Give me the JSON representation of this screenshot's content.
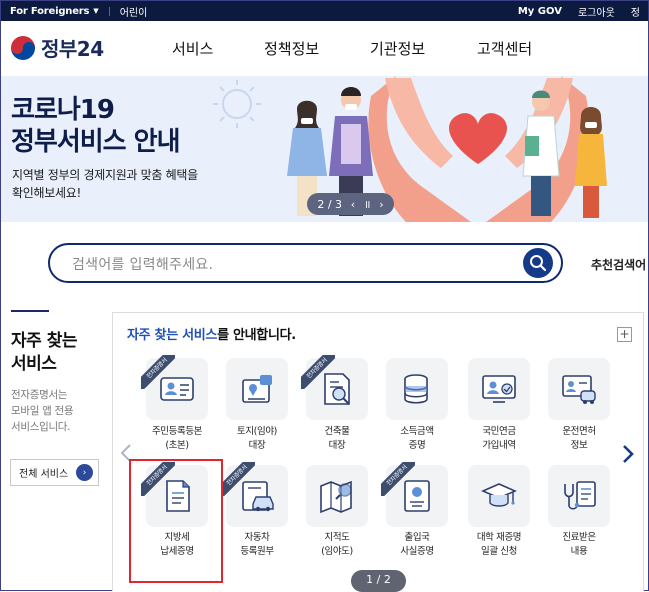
{
  "topbar": {
    "foreigners": "For Foreigners",
    "kids": "어린이",
    "mygov": "My GOV",
    "logout": "로그아웃",
    "extra": "정"
  },
  "header": {
    "logo_text": "정부24",
    "nav": [
      "서비스",
      "정책정보",
      "기관정보",
      "고객센터"
    ]
  },
  "banner": {
    "title_line1": "코로나19",
    "title_line2": "정부서비스 안내",
    "subtitle_line1": "지역별 정부의 경제지원과 맞춤 혜택을",
    "subtitle_line2": "확인해보세요!",
    "pager_text": "2 / 3",
    "prev": "‹",
    "pause": "॥",
    "next": "›"
  },
  "search": {
    "placeholder": "검색어를 입력해주세요.",
    "recommended": "추천검색어"
  },
  "left_panel": {
    "title_line1": "자주 찾는",
    "title_line2": "서비스",
    "desc_line1": "전자증명서는",
    "desc_line2": "모바일 앱 전용",
    "desc_line3": "서비스입니다.",
    "all_services": "전체 서비스"
  },
  "services": {
    "heading_highlight": "자주 찾는 서비스",
    "heading_rest": "를 안내합니다.",
    "plus": "+",
    "ribbon_text": "전자증명서",
    "pager": "1 / 2",
    "items": [
      {
        "line1": "주민등록등본",
        "line2": "(초본)",
        "icon": "id-card-icon"
      },
      {
        "line1": "토지(임야)",
        "line2": "대장",
        "icon": "map-pin-document-icon"
      },
      {
        "line1": "건축물",
        "line2": "대장",
        "icon": "building-document-icon"
      },
      {
        "line1": "소득금액",
        "line2": "증명",
        "icon": "coins-icon"
      },
      {
        "line1": "국민연금",
        "line2": "가입내역",
        "icon": "pension-monitor-icon"
      },
      {
        "line1": "운전면허",
        "line2": "정보",
        "icon": "driver-license-icon"
      },
      {
        "line1": "지방세",
        "line2": "납세증명",
        "icon": "document-icon"
      },
      {
        "line1": "자동차",
        "line2": "등록원부",
        "icon": "car-document-icon"
      },
      {
        "line1": "지적도",
        "line2": "(임야도)",
        "icon": "map-search-icon"
      },
      {
        "line1": "출입국",
        "line2": "사실증명",
        "icon": "passport-icon"
      },
      {
        "line1": "대학 재증명",
        "line2": "일괄 신청",
        "icon": "graduation-cap-icon"
      },
      {
        "line1": "진료받은",
        "line2": "내용",
        "icon": "stethoscope-icon"
      }
    ]
  }
}
